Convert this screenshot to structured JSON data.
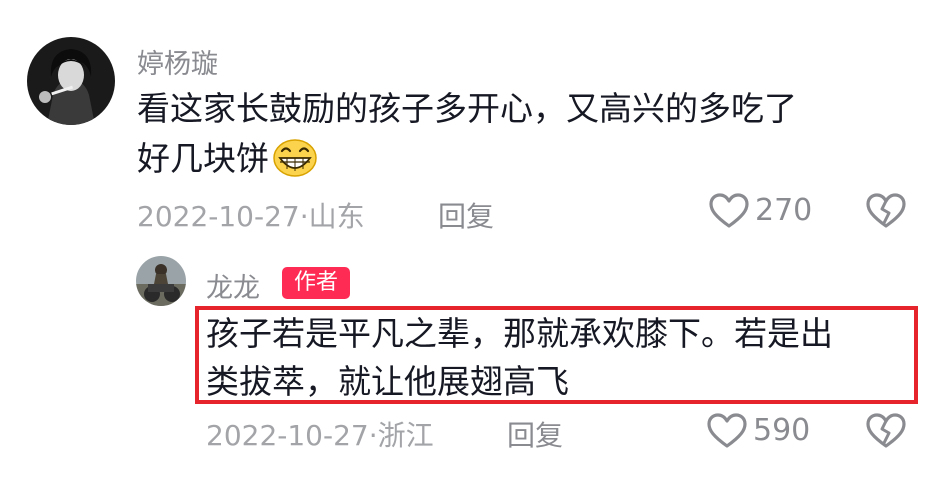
{
  "comment": {
    "username": "婷杨璇",
    "text_line1": "看这家长鼓励的孩子多开心，又高兴的多吃了",
    "text_line2": "好几块饼",
    "emoji": "grinning-face",
    "date": "2022-10-27",
    "location": "山东",
    "reply_label": "回复",
    "like_count": "270"
  },
  "reply": {
    "username": "龙龙",
    "badge": "作者",
    "text_line1": "孩子若是平凡之辈，那就承欢膝下。若是出",
    "text_line2": "类拔萃，就让他展翅高飞",
    "date": "2022-10-27",
    "location": "浙江",
    "reply_label": "回复",
    "like_count": "590"
  },
  "colors": {
    "badge_bg": "#fe2c55",
    "highlight_border": "#e5242b",
    "text_primary": "#161823",
    "text_secondary": "#8a8b91"
  }
}
